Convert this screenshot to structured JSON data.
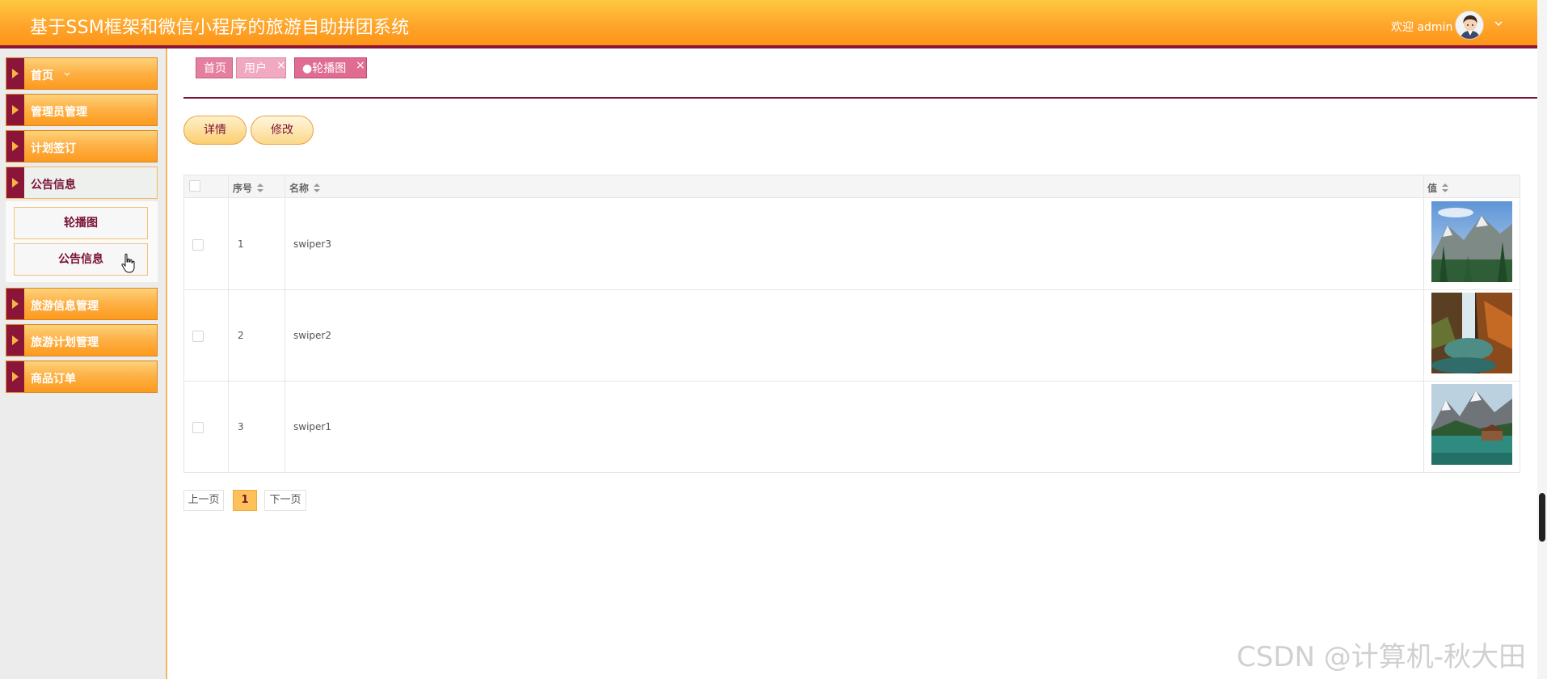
{
  "header": {
    "title": "基于SSM框架和微信小程序的旅游自助拼团系统",
    "welcome": "欢迎 admin",
    "avatar_icon": "user-avatar-icon",
    "dropdown_icon": "chevron-down-icon",
    "background_color": "#fea32a",
    "accent_color": "#8a1538"
  },
  "sidebar": {
    "items": [
      {
        "label": "首页",
        "icon": "triangle-right-icon"
      },
      {
        "label": "管理员管理",
        "icon": "triangle-right-icon"
      },
      {
        "label": "计划签订",
        "icon": "triangle-right-icon"
      },
      {
        "label": "公告信息",
        "icon": "triangle-right-icon",
        "expanded": true,
        "children": [
          {
            "label": "轮播图"
          },
          {
            "label": "公告信息"
          }
        ]
      },
      {
        "label": "旅游信息管理",
        "icon": "triangle-right-icon"
      },
      {
        "label": "旅游计划管理",
        "icon": "triangle-right-icon"
      },
      {
        "label": "商品订单",
        "icon": "triangle-right-icon"
      }
    ]
  },
  "tabs": [
    {
      "label": "首页",
      "closable": false,
      "color": "#e57fa0"
    },
    {
      "label": "用户",
      "closable": true,
      "color": "#f0a9c0"
    },
    {
      "label": "●轮播图",
      "closable": true,
      "active": true,
      "color": "#e06c92"
    }
  ],
  "toolbar": {
    "detail_label": "详情",
    "edit_label": "修改"
  },
  "table": {
    "columns": [
      "序号",
      "名称",
      "值"
    ],
    "rows": [
      {
        "index": "1",
        "name": "swiper3",
        "image": "mountain-lake-photo"
      },
      {
        "index": "2",
        "name": "swiper2",
        "image": "waterfall-photo"
      },
      {
        "index": "3",
        "name": "swiper1",
        "image": "alpine-lake-photo"
      }
    ]
  },
  "pagination": {
    "prev_label": "上一页",
    "current_page": "1",
    "next_label": "下一页"
  },
  "watermark": "CSDN @计算机-秋大田"
}
